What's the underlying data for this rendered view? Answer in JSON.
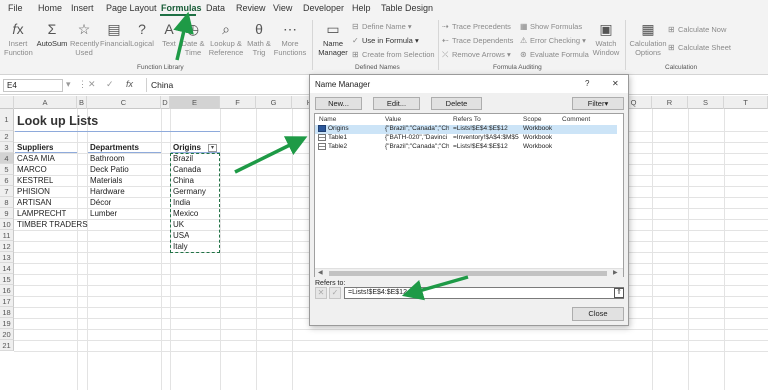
{
  "menu": {
    "items": [
      "File",
      "Home",
      "Insert",
      "Page Layout",
      "Formulas",
      "Data",
      "Review",
      "View",
      "Developer",
      "Help",
      "Table Design"
    ],
    "active": "Formulas"
  },
  "ribbon": {
    "insert_function": "Insert\nFunction",
    "autosum": "AutoSum",
    "recently_used": "Recently\nUsed",
    "financial": "Financial",
    "logical": "Logical",
    "text": "Text",
    "date_time": "Date &\nTime",
    "lookup": "Lookup &\nReference",
    "math": "Math &\nTrig",
    "more": "More\nFunctions",
    "name_manager": "Name\nManager",
    "define_name": "Define Name",
    "use_in_formula": "Use in Formula",
    "create_from_selection": "Create from Selection",
    "trace_precedents": "Trace Precedents",
    "trace_dependents": "Trace Dependents",
    "remove_arrows": "Remove Arrows",
    "show_formulas": "Show Formulas",
    "error_checking": "Error Checking",
    "evaluate_formula": "Evaluate Formula",
    "watch_window": "Watch\nWindow",
    "calc_options": "Calculation\nOptions",
    "calc_now": "Calculate Now",
    "calc_sheet": "Calculate Sheet",
    "groups": [
      "Function Library",
      "Defined Names",
      "Formula Auditing",
      "Calculation"
    ]
  },
  "formula_bar": {
    "name_box": "E4",
    "content": "China"
  },
  "columns": [
    "A",
    "B",
    "C",
    "D",
    "E",
    "F",
    "G",
    "H",
    "I",
    "J",
    "K",
    "L",
    "M",
    "N",
    "O",
    "P",
    "Q",
    "R",
    "S",
    "T"
  ],
  "rows": [
    "1",
    "2",
    "3",
    "4",
    "5",
    "6",
    "7",
    "8",
    "9",
    "10",
    "11",
    "12",
    "13",
    "14",
    "15",
    "16",
    "17",
    "18",
    "19",
    "20",
    "21"
  ],
  "sheet": {
    "title": "Look up Lists",
    "headers": {
      "suppliers": "Suppliers",
      "departments": "Departments",
      "origins": "Origins"
    },
    "suppliers": [
      "CASA MIA",
      "MARCO",
      "KESTREL",
      "PHISION",
      "ARTISAN",
      "LAMPRECHT",
      "TIMBER TRADERS"
    ],
    "departments": [
      "Bathroom",
      "Deck Patio",
      "Materials",
      "Hardware",
      "Décor",
      "Lumber"
    ],
    "origins": [
      "Brazil",
      "Canada",
      "China",
      "Germany",
      "India",
      "Mexico",
      "UK",
      "USA",
      "Italy"
    ]
  },
  "dialog": {
    "title": "Name Manager",
    "help": "?",
    "close_x": "✕",
    "buttons": {
      "new": "New...",
      "edit": "Edit...",
      "delete": "Delete",
      "filter": "Filter",
      "close": "Close"
    },
    "list_headers": [
      "Name",
      "Value",
      "Refers To",
      "Scope",
      "Comment"
    ],
    "names": [
      {
        "name": "Origins",
        "value": "{\"Brazil\";\"Canada\";\"Chi...",
        "refers": "=Lists!$E$4:$E$12",
        "scope": "Workbook"
      },
      {
        "name": "Table1",
        "value": "{\"BATH-020\",\"Davinci ...",
        "refers": "=Inventory!$A$4:$M$54",
        "scope": "Workbook"
      },
      {
        "name": "Table2",
        "value": "{\"Brazil\";\"Canada\";\"Chi...",
        "refers": "=Lists!$E$4:$E$12",
        "scope": "Workbook"
      }
    ],
    "refers_to_label": "Refers to:",
    "refers_to_value": "=Lists!$E$4:$E$12"
  },
  "colors": {
    "accent": "#1e7145",
    "arrow": "#1e9a46",
    "selection": "#cce4f7"
  }
}
